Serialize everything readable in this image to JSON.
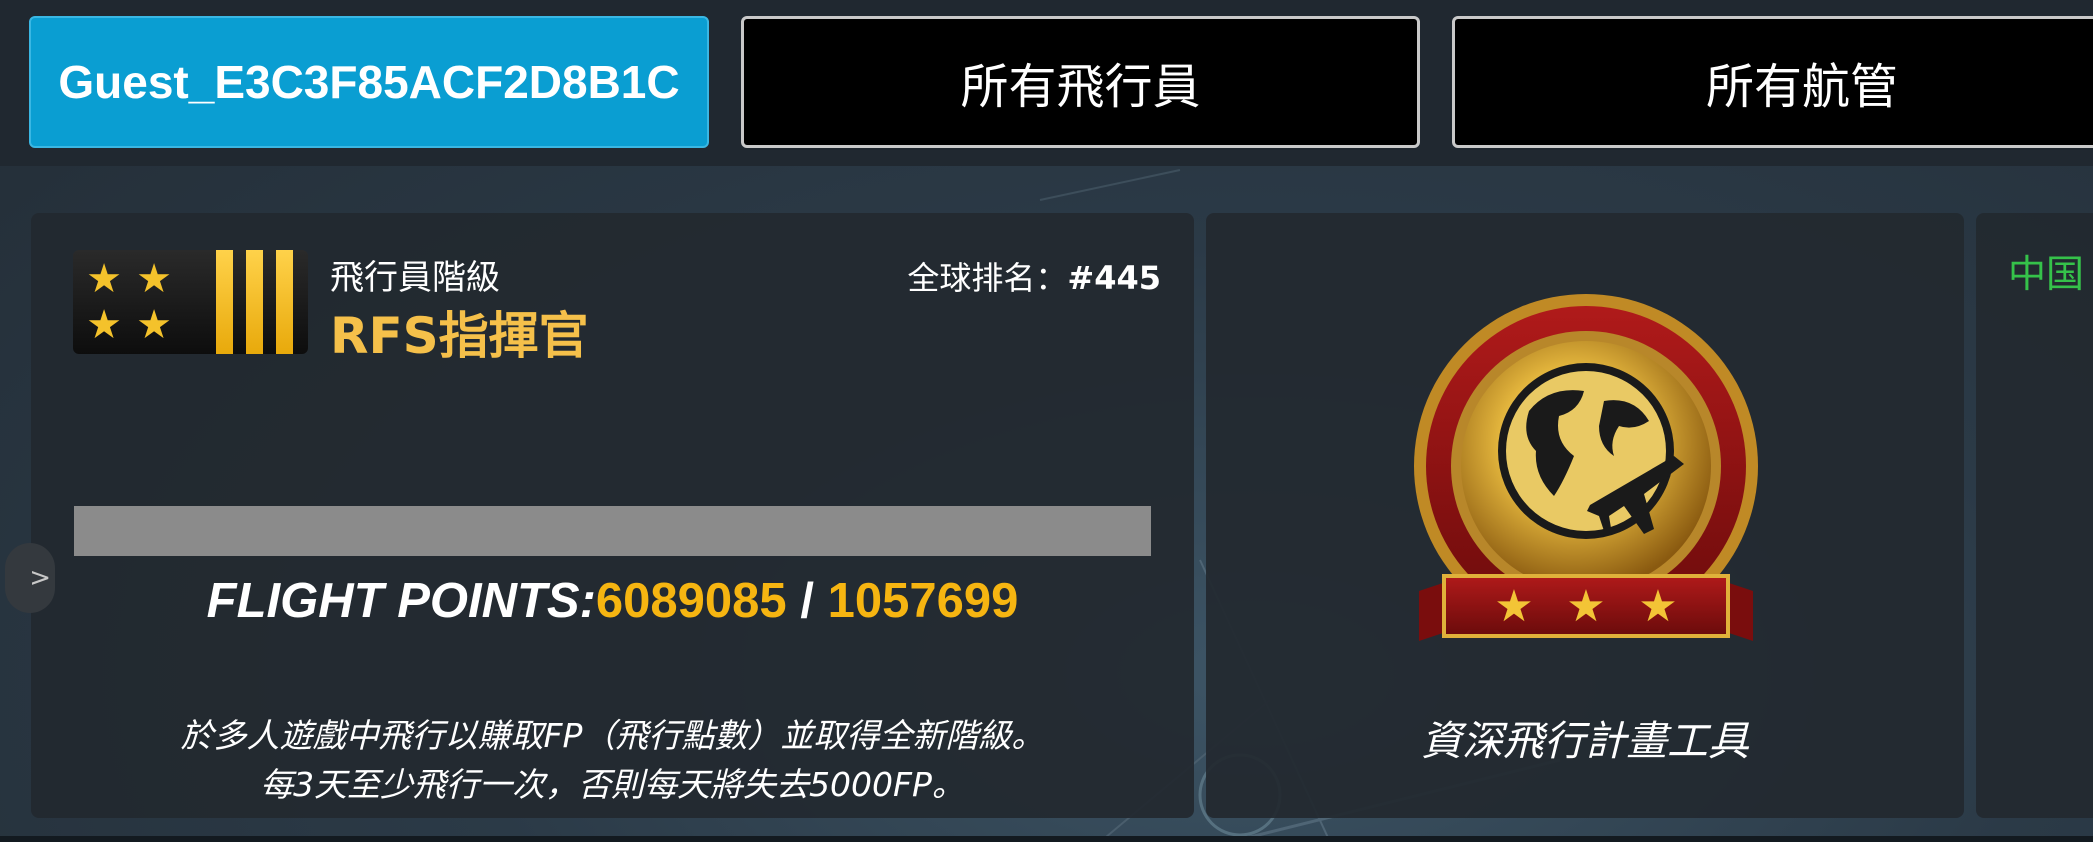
{
  "tabs": {
    "user_label": "Guest_E3C3F85ACF2D8B1C",
    "pilots_label": "所有飛行員",
    "atc_label": "所有航管"
  },
  "rank_panel": {
    "caption": "飛行員階級",
    "rank_name": "RFS指揮官",
    "global_rank_label": "全球排名：",
    "global_rank_value": "#445",
    "progress_fraction": 0.0,
    "fp_label": "FLIGHT POINTS:",
    "fp_current": "6089085",
    "fp_separator": "/",
    "fp_target": "1057699",
    "note_line1": "於多人遊戲中飛行以賺取FP（飛行點數）並取得全新階級。",
    "note_line2": "每3天至少飛行一次，否則每天將失去5000FP。"
  },
  "planner_panel": {
    "title": "資深飛行計畫工具",
    "icon": "globe-airplane-medal-icon"
  },
  "right_panel": {
    "region_label": "中国"
  },
  "colors": {
    "user_tab": "#0a9ed2",
    "rank_gold": "#f5c04a",
    "fp_value": "#f6b511",
    "region_green": "#35c24a"
  }
}
